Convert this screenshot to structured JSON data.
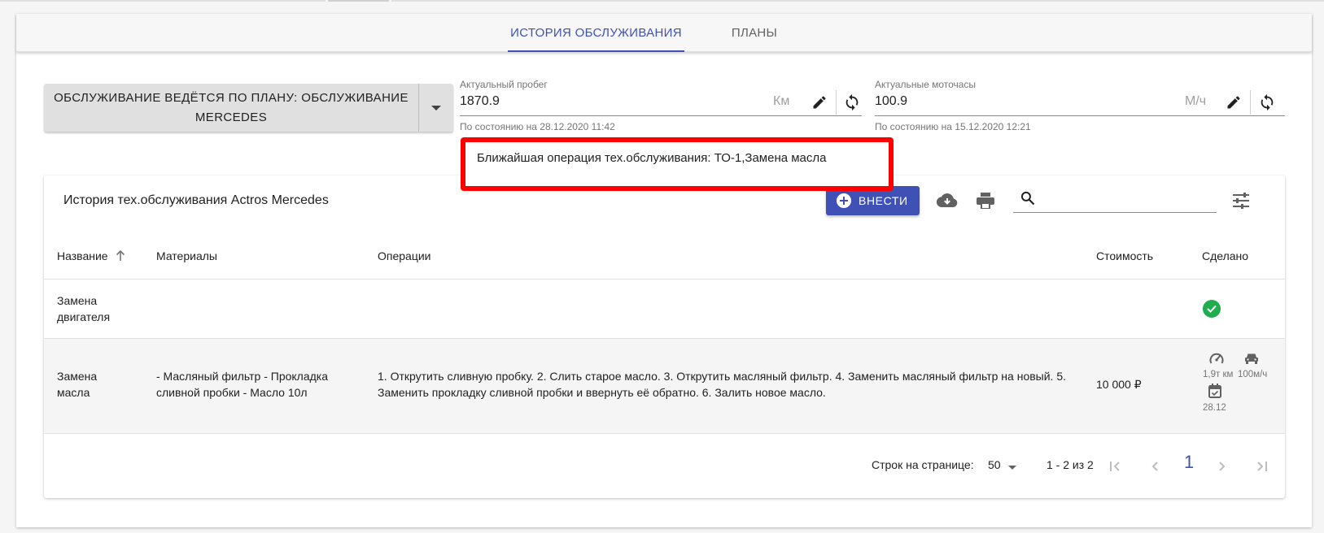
{
  "tabs": [
    {
      "label": "История обслуживания",
      "active": true
    },
    {
      "label": "Планы",
      "active": false
    }
  ],
  "plan_button": {
    "label": "Обслуживание ведётся по плану: Обслуживание Mercedes"
  },
  "mileage": {
    "label": "Актуальный пробег",
    "value": "1870.9",
    "unit": "Км",
    "hint": "По состоянию на 28.12.2020 11:42"
  },
  "engine_hours": {
    "label": "Актуальные моточасы",
    "value": "100.9",
    "unit": "М/ч",
    "hint": "По состоянию на 15.12.2020 12:21"
  },
  "next_operation": "Ближайшая операция тех.обслуживания: ТО-1,Замена масла",
  "history": {
    "title": "История тех.обслуживания Actros Mercedes",
    "add_button": "Внести",
    "search_placeholder": "",
    "columns": {
      "name": "Название",
      "materials": "Материалы",
      "operations": "Операции",
      "cost": "Стоимость",
      "done": "Сделано"
    },
    "rows": [
      {
        "name": "Замена двигателя",
        "materials": "",
        "operations": "",
        "cost": "",
        "done_status": "completed"
      },
      {
        "name": "Замена масла",
        "materials": "- Масляный фильтр - Прокладка сливной пробки - Масло 10л",
        "operations": "1. Открутить сливную пробку. 2. Слить старое масло. 3. Открутить масляный фильтр. 4. Заменить масляный фильтр на новый. 5. Заменить прокладку сливной пробки и ввернуть её обратно. 6. Залить новое масло.",
        "cost": "10 000 ₽",
        "done_mileage": "1,9т км",
        "done_hours": "100м/ч",
        "done_date": "28.12"
      }
    ],
    "pagination": {
      "rows_per_page_label": "Строк на странице:",
      "rows_per_page": "50",
      "range": "1 - 2 из 2",
      "current_page": "1"
    }
  },
  "colors": {
    "primary": "#3f51b5",
    "success": "#21ad4f",
    "highlight": "#ff0000"
  }
}
